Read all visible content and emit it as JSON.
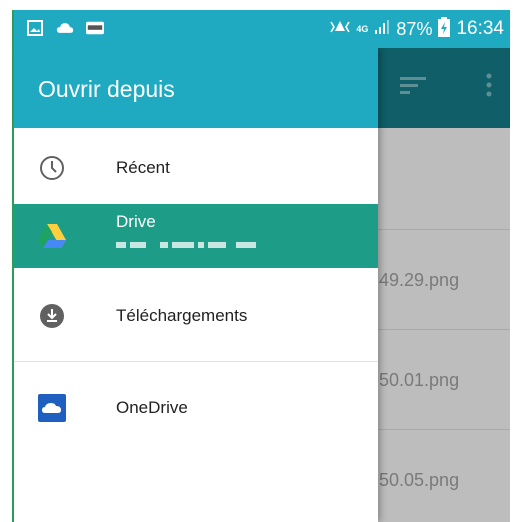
{
  "status_bar": {
    "network": "4G",
    "battery": "87%",
    "time": "16:34",
    "notification_icons": [
      "image-icon",
      "cloud-icon",
      "good-app-icon"
    ]
  },
  "drawer": {
    "title": "Ouvrir depuis",
    "items": [
      {
        "label": "Récent",
        "icon": "clock-icon"
      },
      {
        "label": "Drive",
        "icon": "google-drive-icon",
        "selected": true
      },
      {
        "label": "Téléchargements",
        "icon": "download-icon"
      },
      {
        "label": "OneDrive",
        "icon": "onedrive-icon"
      }
    ]
  },
  "background_files": [
    {
      "name_fragment": ".49.29.png"
    },
    {
      "name_fragment": ".50.01.png"
    },
    {
      "name_fragment": ".50.05.png"
    }
  ],
  "colors": {
    "accent": "#1faac2",
    "selected": "#1d9d87",
    "toolbar_dark": "#0f5e68"
  }
}
